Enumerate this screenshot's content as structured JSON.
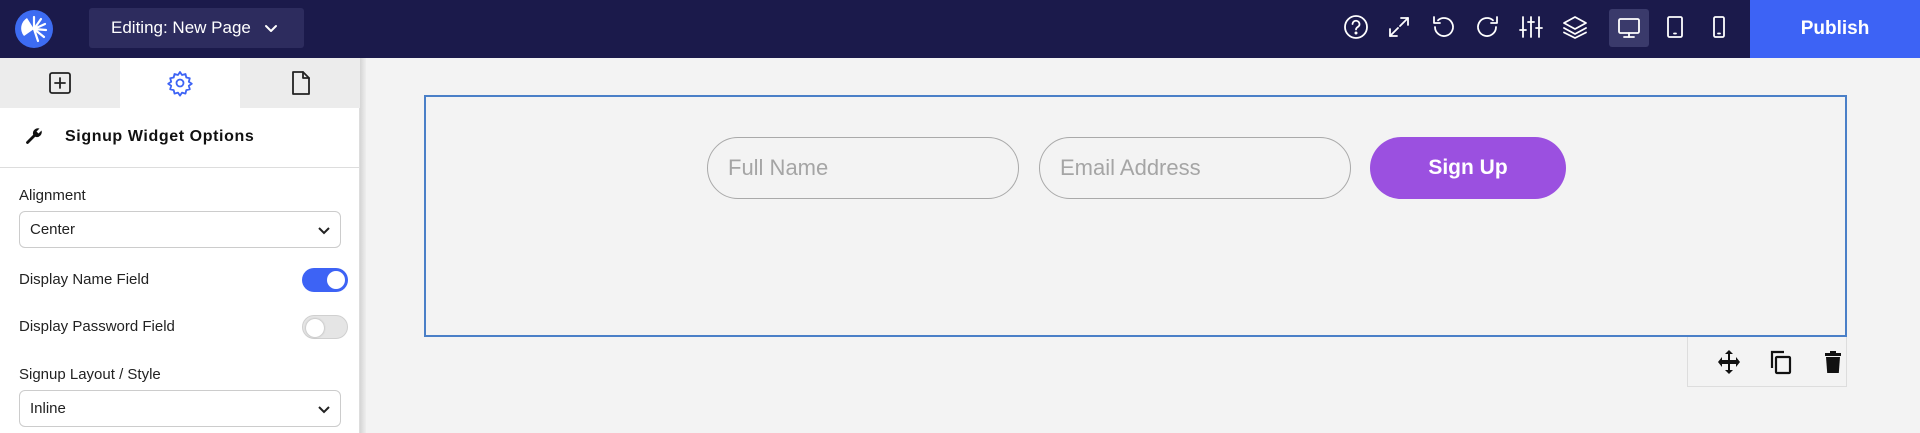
{
  "topbar": {
    "editing_label": "Editing: New Page",
    "publish_label": "Publish",
    "icons": [
      "help-icon",
      "expand-icon",
      "undo-icon",
      "redo-icon",
      "sliders-icon",
      "layers-icon",
      "desktop-icon",
      "tablet-icon",
      "mobile-icon"
    ]
  },
  "sidebar": {
    "tabs": [
      "add-icon",
      "gear-icon",
      "page-icon"
    ],
    "section_title": "Signup Widget Options",
    "alignment_label": "Alignment",
    "alignment_value": "Center",
    "display_name_label": "Display Name Field",
    "display_name_on": true,
    "display_password_label": "Display Password Field",
    "display_password_on": false,
    "layout_label": "Signup Layout / Style",
    "layout_value": "Inline"
  },
  "canvas": {
    "name_placeholder": "Full Name",
    "email_placeholder": "Email Address",
    "signup_label": "Sign Up",
    "tools": [
      "move-icon",
      "duplicate-icon",
      "delete-icon"
    ]
  },
  "colors": {
    "topbar": "#1b1a4b",
    "accent": "#3d63f5",
    "signup_button": "#9b50e0",
    "widget_border": "#4a7fc7"
  }
}
